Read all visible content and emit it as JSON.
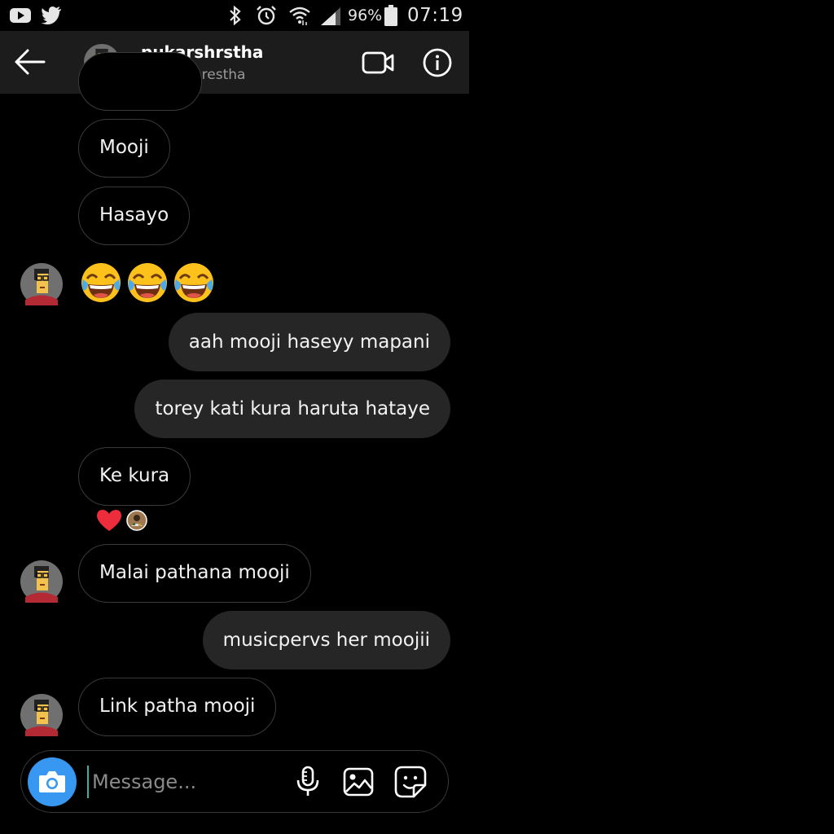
{
  "status_bar": {
    "battery": "96%",
    "time": "07:19",
    "icons": [
      "youtube-icon",
      "twitter-icon",
      "bluetooth-icon",
      "alarm-icon",
      "wifi-icon",
      "signal-icon",
      "battery-icon"
    ]
  },
  "header": {
    "username": "pukarshrstha",
    "full_name": "Pukar Shrestha",
    "icons": [
      "back-arrow-icon",
      "video-call-icon",
      "info-icon"
    ]
  },
  "messages": [
    {
      "side": "in",
      "text": "Mooji"
    },
    {
      "side": "in",
      "text": "Hasayo"
    },
    {
      "side": "in",
      "type": "emoji",
      "emoji": [
        "😂",
        "😂",
        "😂"
      ]
    },
    {
      "side": "out",
      "text": "aah mooji haseyy mapani"
    },
    {
      "side": "out",
      "text": "torey kati kura haruta hataye"
    },
    {
      "side": "in",
      "text": "Ke kura",
      "reaction": "❤"
    },
    {
      "side": "in",
      "text": "Malai pathana mooji"
    },
    {
      "side": "out",
      "text": "musicpervs her moojii"
    },
    {
      "side": "in",
      "text": "Link patha mooji"
    }
  ],
  "composer": {
    "placeholder": "Message...",
    "icons": [
      "camera-icon",
      "microphone-icon",
      "gallery-icon",
      "sticker-icon"
    ]
  },
  "colors": {
    "header_bg": "#1c1c1c",
    "outgoing_bubble": "#262626",
    "incoming_border": "#3a3a3a",
    "camera_button": "#3897f0",
    "reaction_heart": "#ed2d3c"
  }
}
